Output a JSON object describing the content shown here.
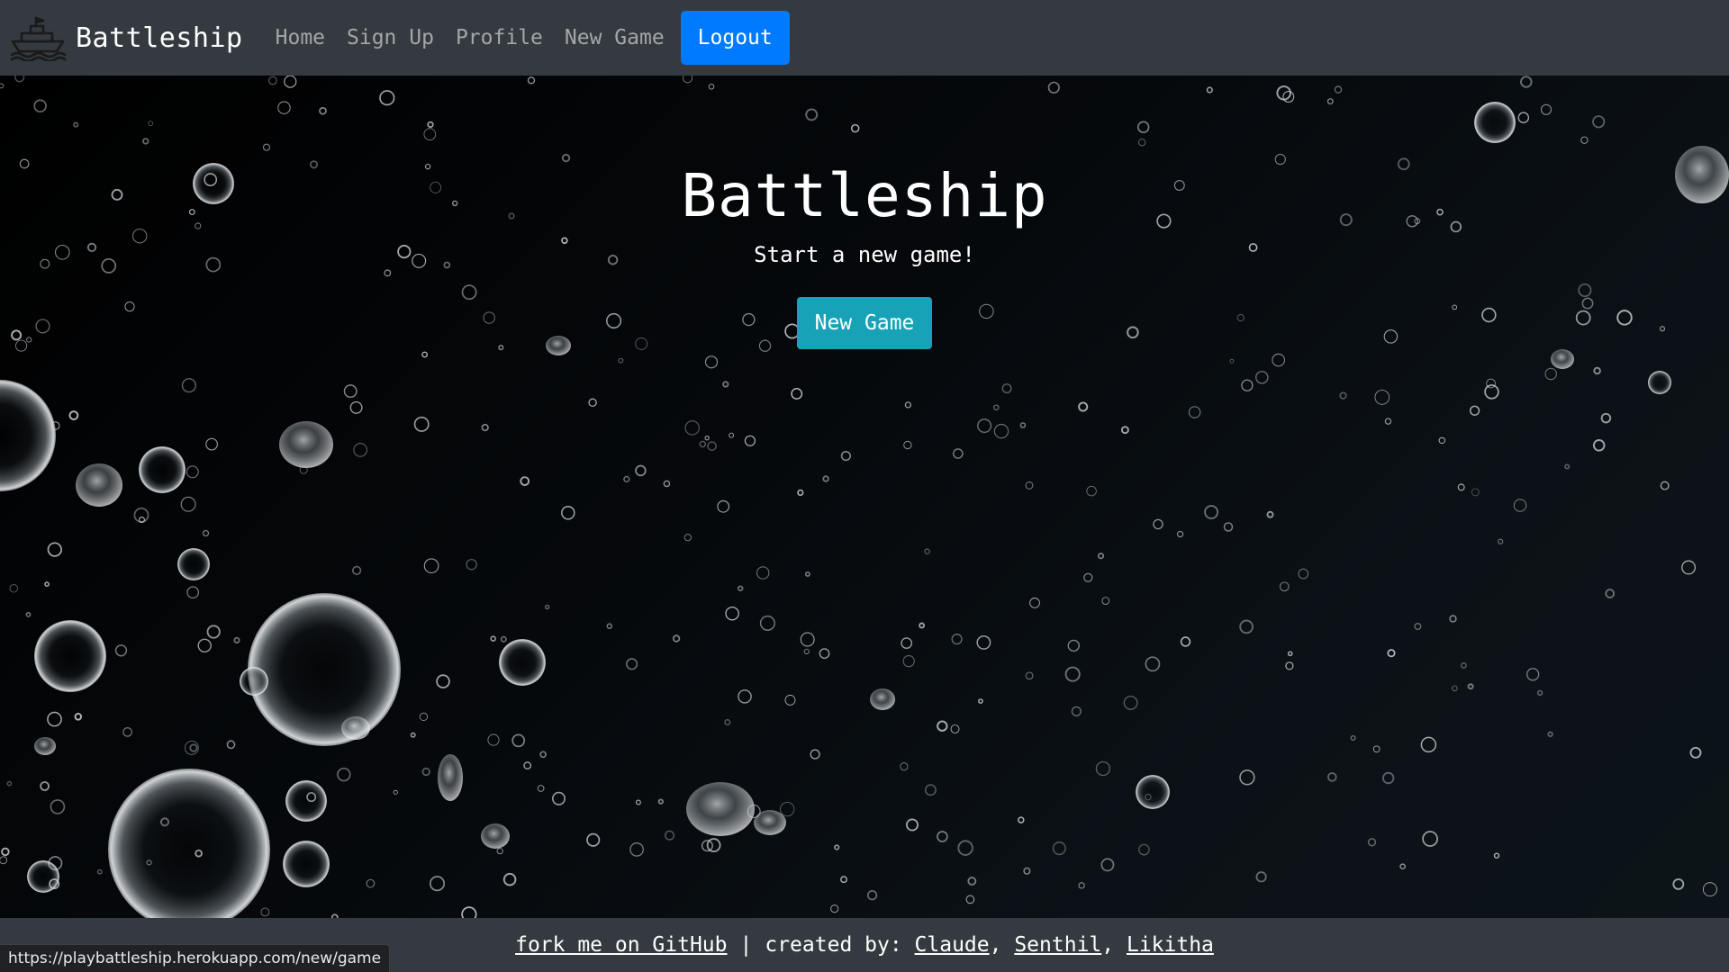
{
  "navbar": {
    "brand": "Battleship",
    "brand_icon": "ship-icon",
    "links": [
      "Home",
      "Sign Up",
      "Profile",
      "New Game"
    ],
    "logout_label": "Logout",
    "colors": {
      "background": "#343a40",
      "logout": "#007bff"
    }
  },
  "hero": {
    "title": "Battleship",
    "subtitle": "Start a new game!",
    "button_label": "New Game",
    "background": "underwater bubbles",
    "colors": {
      "button": "#17a2b8"
    }
  },
  "footer": {
    "github_link": "fork me on GitHub",
    "separator": "|",
    "created_by_label": "created by: ",
    "authors": [
      "Claude",
      "Senthil",
      "Likitha"
    ],
    "comma": ", "
  },
  "status_bar": {
    "url": "https://playbattleship.herokuapp.com/new/game"
  }
}
